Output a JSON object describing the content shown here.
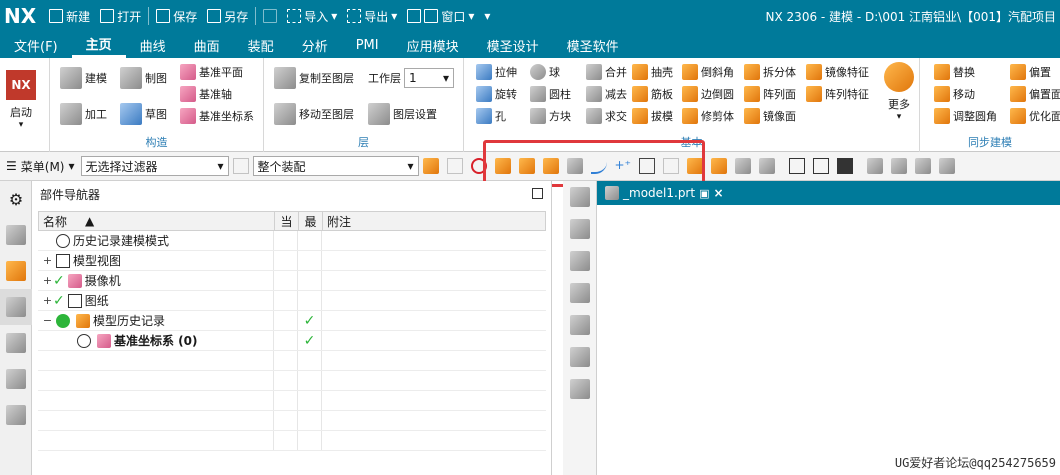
{
  "titlebar": {
    "logo": "NX",
    "new": "新建",
    "open": "打开",
    "save": "保存",
    "save_as": "另存",
    "import": "导入",
    "export": "导出",
    "window": "窗口",
    "title": "NX 2306 - 建模 - D:\\001 江南铝业\\【001】汽配项目"
  },
  "menu_tabs": [
    "文件(F)",
    "主页",
    "曲线",
    "曲面",
    "装配",
    "分析",
    "PMI",
    "应用模块",
    "模圣设计",
    "模圣软件"
  ],
  "ribbon": {
    "start_label": "启动",
    "start_logo": "NX",
    "construct": {
      "label": "构造",
      "items": [
        "建模",
        "制图",
        "加工",
        "草图",
        "基准平面",
        "基准轴",
        "基准坐标系"
      ]
    },
    "layer": {
      "label": "层",
      "copy_to_layer": "复制至图层",
      "move_to_layer": "移动至图层",
      "work_layer_label": "工作层",
      "work_layer_value": "1",
      "layer_settings": "图层设置"
    },
    "basic": {
      "label": "基本",
      "col1": [
        "拉伸",
        "旋转",
        "孔"
      ],
      "col2": [
        "球",
        "圆柱",
        "方块"
      ],
      "col3": [
        "合并",
        "减去",
        "求交"
      ],
      "col4": [
        "抽壳",
        "筋板",
        "拔模"
      ],
      "col5": [
        "倒斜角",
        "边倒圆",
        "修剪体"
      ],
      "col6": [
        "拆分体",
        "阵列面",
        "镜像面"
      ],
      "col7": [
        "镜像特征",
        "阵列特征"
      ],
      "more": "更多"
    },
    "sync": {
      "label": "同步建模",
      "col1": [
        "替换",
        "移动",
        "调整圆角"
      ],
      "col2": [
        "偏置",
        "偏置面",
        "优化面"
      ]
    }
  },
  "toolbar": {
    "menu_label": "菜单(M)",
    "filter_value": "无选择过滤器",
    "scope_value": "整个装配"
  },
  "navigator": {
    "title": "部件导航器",
    "columns": [
      "名称",
      "当",
      "最",
      "附注"
    ],
    "rows": [
      {
        "expander": "",
        "name": "历史记录建模模式",
        "cur": "",
        "last": "",
        "bold": false
      },
      {
        "expander": "+",
        "name": "模型视图",
        "cur": "",
        "last": "",
        "bold": false
      },
      {
        "expander": "+",
        "name": "摄像机",
        "cur": "",
        "last": "",
        "bold": false
      },
      {
        "expander": "+",
        "name": "图纸",
        "cur": "",
        "last": "",
        "bold": false
      },
      {
        "expander": "−",
        "name": "模型历史记录",
        "cur": "",
        "last": "✓",
        "bold": false
      },
      {
        "expander": "",
        "name": "基准坐标系 (0)",
        "cur": "",
        "last": "✓",
        "bold": true
      }
    ]
  },
  "viewport": {
    "tab_label": "_model1.prt"
  },
  "watermark": "UG爱好者论坛@qq254275659",
  "colors": {
    "titlebar": "#007a9a",
    "highlight": "#e0383c",
    "check": "#2db53a"
  }
}
